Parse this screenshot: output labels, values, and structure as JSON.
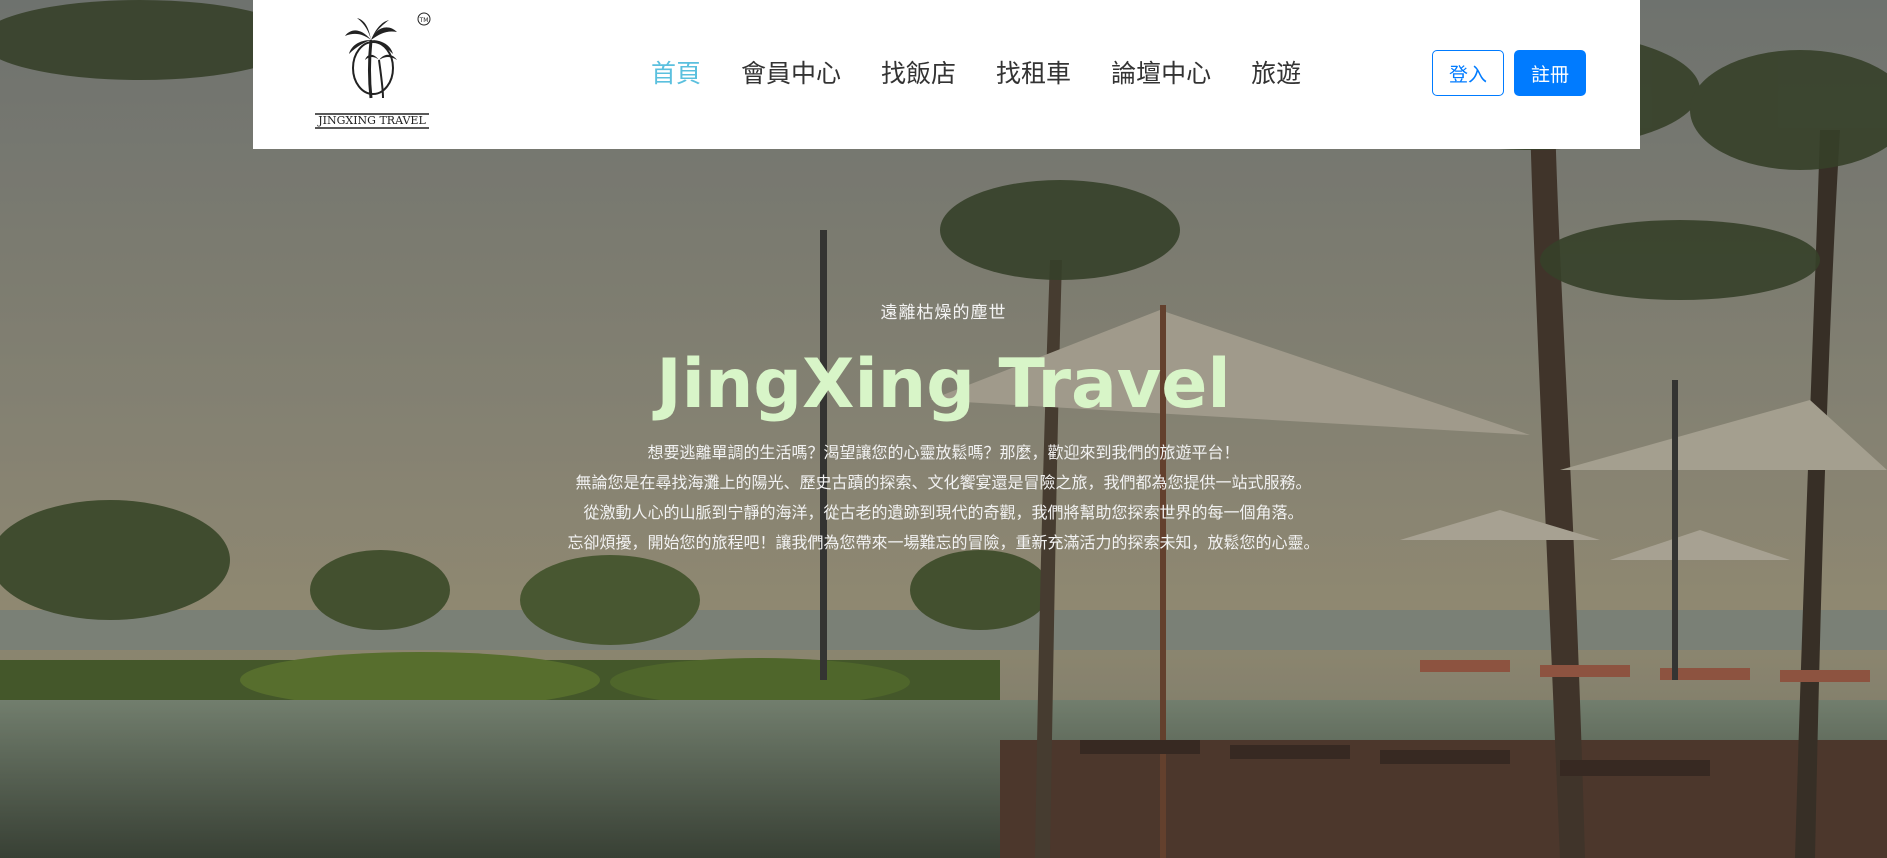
{
  "logo": {
    "brand_text": "JINGXING TRAVEL",
    "trademark": "TM"
  },
  "nav": {
    "items": [
      {
        "label": "首頁",
        "active": true
      },
      {
        "label": "會員中心",
        "active": false
      },
      {
        "label": "找飯店",
        "active": false
      },
      {
        "label": "找租車",
        "active": false
      },
      {
        "label": "論壇中心",
        "active": false
      },
      {
        "label": "旅遊",
        "active": false
      }
    ],
    "active_color": "#5bc0de"
  },
  "auth": {
    "login_label": "登入",
    "register_label": "註冊",
    "accent_color": "#007bff"
  },
  "hero": {
    "eyebrow": "遠離枯燥的塵世",
    "title": "JingXing Travel",
    "description": [
      "想要逃離單調的生活嗎？渴望讓您的心靈放鬆嗎？那麼，歡迎來到我們的旅遊平台！",
      "無論您是在尋找海灘上的陽光、歷史古蹟的探索、文化饗宴還是冒險之旅，我們都為您提供一站式服務。",
      "從激動人心的山脈到宁靜的海洋，從古老的遺跡到現代的奇觀，我們將幫助您探索世界的每一個角落。",
      "忘卻煩擾，開始您的旅程吧！讓我們為您帶來一場難忘的冒險，重新充滿活力的探索未知，放鬆您的心靈。"
    ],
    "title_color": "#d8f5c8"
  }
}
